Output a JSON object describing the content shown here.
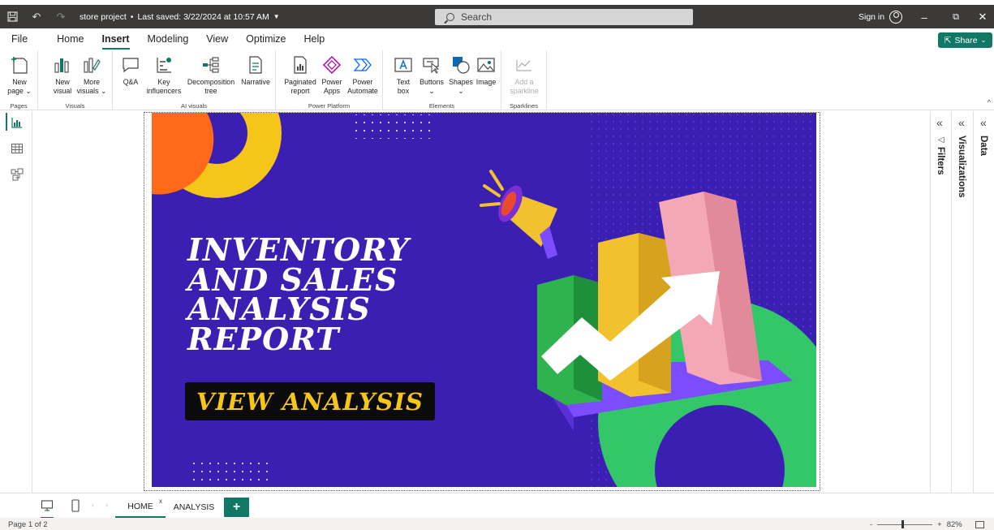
{
  "titlebar": {
    "doc_title": "store project",
    "separator": "•",
    "saved": "Last saved: 3/22/2024 at 10:57 AM",
    "search_placeholder": "Search",
    "sign_in": "Sign in",
    "minimize": "–",
    "restore": "⧉",
    "close": "✕"
  },
  "menu": {
    "tabs": [
      "File",
      "Home",
      "Insert",
      "Modeling",
      "View",
      "Optimize",
      "Help"
    ],
    "active": "Insert",
    "share": "Share"
  },
  "ribbon": {
    "groups": {
      "pages": "Pages",
      "visuals": "Visuals",
      "ai_visuals": "AI visuals",
      "power_platform": "Power Platform",
      "elements": "Elements",
      "sparklines": "Sparklines"
    },
    "buttons": {
      "new_page": [
        "New",
        "page ⌄"
      ],
      "new_visual": [
        "New",
        "visual"
      ],
      "more_visuals": [
        "More",
        "visuals ⌄"
      ],
      "qa": [
        "Q&A",
        ""
      ],
      "key_influencers": [
        "Key",
        "influencers"
      ],
      "decomposition_tree": [
        "Decomposition",
        "tree"
      ],
      "narrative": [
        "Narrative",
        ""
      ],
      "paginated_report": [
        "Paginated",
        "report"
      ],
      "power_apps": [
        "Power",
        "Apps"
      ],
      "power_automate": [
        "Power",
        "Automate"
      ],
      "text_box": [
        "Text",
        "box"
      ],
      "buttons": [
        "Buttons",
        "⌄"
      ],
      "shapes": [
        "Shapes",
        "⌄"
      ],
      "image": [
        "Image",
        ""
      ],
      "add_sparkline": [
        "Add a",
        "sparkline"
      ]
    }
  },
  "report": {
    "title_lines": [
      "INVENTORY",
      "AND SALES",
      "ANALYSIS",
      "REPORT"
    ],
    "button": "VIEW ANALYSIS"
  },
  "panes": {
    "filters": "Filters",
    "visualizations": "Visualizations",
    "data": "Data"
  },
  "page_tabs": {
    "tabs": [
      "HOME",
      "ANALYSIS"
    ],
    "active": "HOME",
    "add": "+"
  },
  "status": {
    "page": "Page 1 of 2",
    "zoom": "82%",
    "minus": "-",
    "plus": "+"
  },
  "colors": {
    "accent": "#117865",
    "report_bg": "#3b1fb2",
    "title_text": "#ffffff",
    "button_text": "#f5c518"
  }
}
